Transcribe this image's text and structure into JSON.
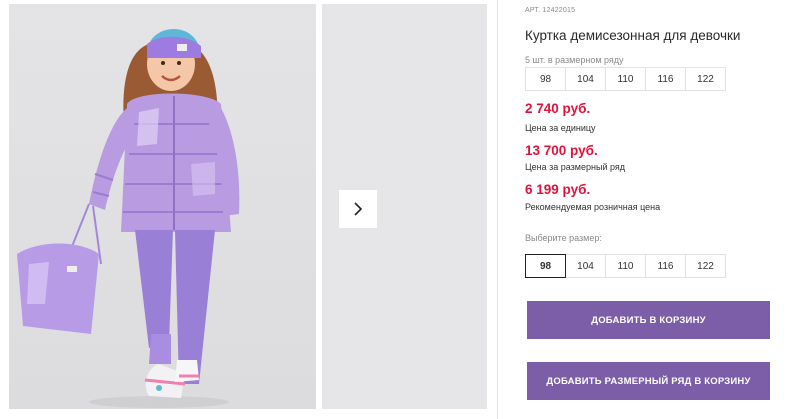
{
  "product": {
    "article": "АРТ. 12422015",
    "title": "Куртка демисезонная для девочки",
    "row_note": "5 шт. в размерном ряду",
    "row_sizes": [
      "98",
      "104",
      "110",
      "116",
      "122"
    ]
  },
  "prices": {
    "unit_price": "2 740 руб.",
    "unit_caption": "Цена за единицу",
    "row_price": "13 700 руб.",
    "row_caption": "Цена за размерный ряд",
    "retail_price": "6 199 руб.",
    "retail_caption": "Рекомендуемая розничная цена"
  },
  "size_picker": {
    "label": "Выберите размер:",
    "options": [
      "98",
      "104",
      "110",
      "116",
      "122"
    ],
    "selected": "98"
  },
  "actions": {
    "add_to_cart": "ДОБАВИТЬ В КОРЗИНУ",
    "add_row_to_cart": "ДОБАВИТЬ РАЗМЕРНЫЙ РЯД В КОРЗИНУ"
  },
  "gallery": {
    "next_icon": "chevron-right-icon"
  },
  "colors": {
    "accent": "#7b5ea7",
    "price": "#e0123a",
    "jacket": "#b89be0"
  }
}
